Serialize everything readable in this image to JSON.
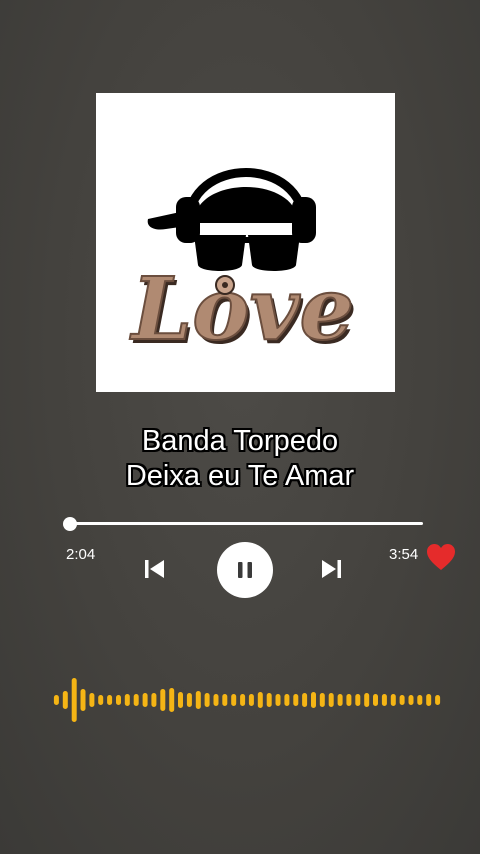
{
  "player": {
    "artist": "Banda Torpedo",
    "song": "Deixa eu Te Amar",
    "elapsed": "2:04",
    "total": "3:54",
    "progress_fraction": 0.0,
    "liked": true
  },
  "colors": {
    "accent_wave": "#f5b515",
    "heart": "#e52b2b",
    "cover_letters": "#b08a72"
  },
  "cover": {
    "art_text": "Love"
  },
  "icons": {
    "previous": "skip-previous-icon",
    "pause": "pause-icon",
    "next": "skip-next-icon",
    "like": "heart-icon"
  }
}
